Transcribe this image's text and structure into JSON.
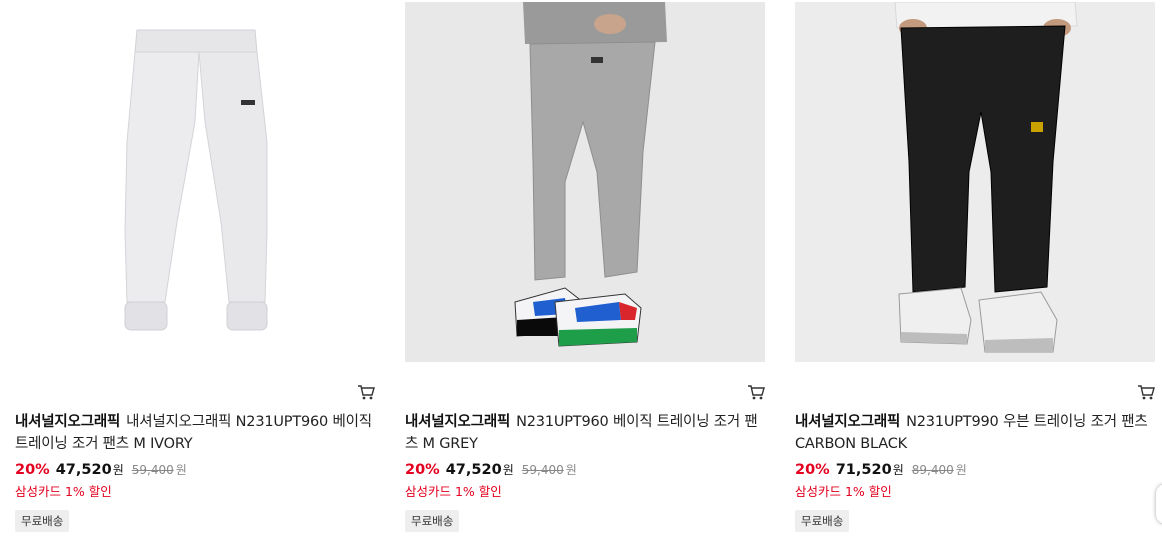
{
  "products": [
    {
      "brand": "내셔널지오그래픽",
      "name": "내셔널지오그래픽 N231UPT960 베이직 트레이닝 조거 팬츠 M IVORY",
      "discount_rate": "20%",
      "price": "47,520",
      "currency": "원",
      "original_price": "59,400",
      "card_discount": "삼성카드 1% 할인",
      "shipping_badge": "무료배송",
      "image_icon": "ivory-jogger-pants-image"
    },
    {
      "brand": "내셔널지오그래픽",
      "name": "N231UPT960 베이직 트레이닝 조거 팬츠 M GREY",
      "discount_rate": "20%",
      "price": "47,520",
      "currency": "원",
      "original_price": "59,400",
      "card_discount": "삼성카드 1% 할인",
      "shipping_badge": "무료배송",
      "image_icon": "grey-jogger-pants-model-image"
    },
    {
      "brand": "내셔널지오그래픽",
      "name": "N231UPT990 우븐 트레이닝 조거 팬츠 CARBON BLACK",
      "discount_rate": "20%",
      "price": "71,520",
      "currency": "원",
      "original_price": "89,400",
      "card_discount": "삼성카드 1% 할인",
      "shipping_badge": "무료배송",
      "image_icon": "black-jogger-pants-model-image"
    }
  ],
  "colors": {
    "discount_red": "#e4001f",
    "badge_bg": "#eeeeee",
    "strike_gray": "#888888"
  },
  "icons": {
    "cart": "cart-icon"
  }
}
